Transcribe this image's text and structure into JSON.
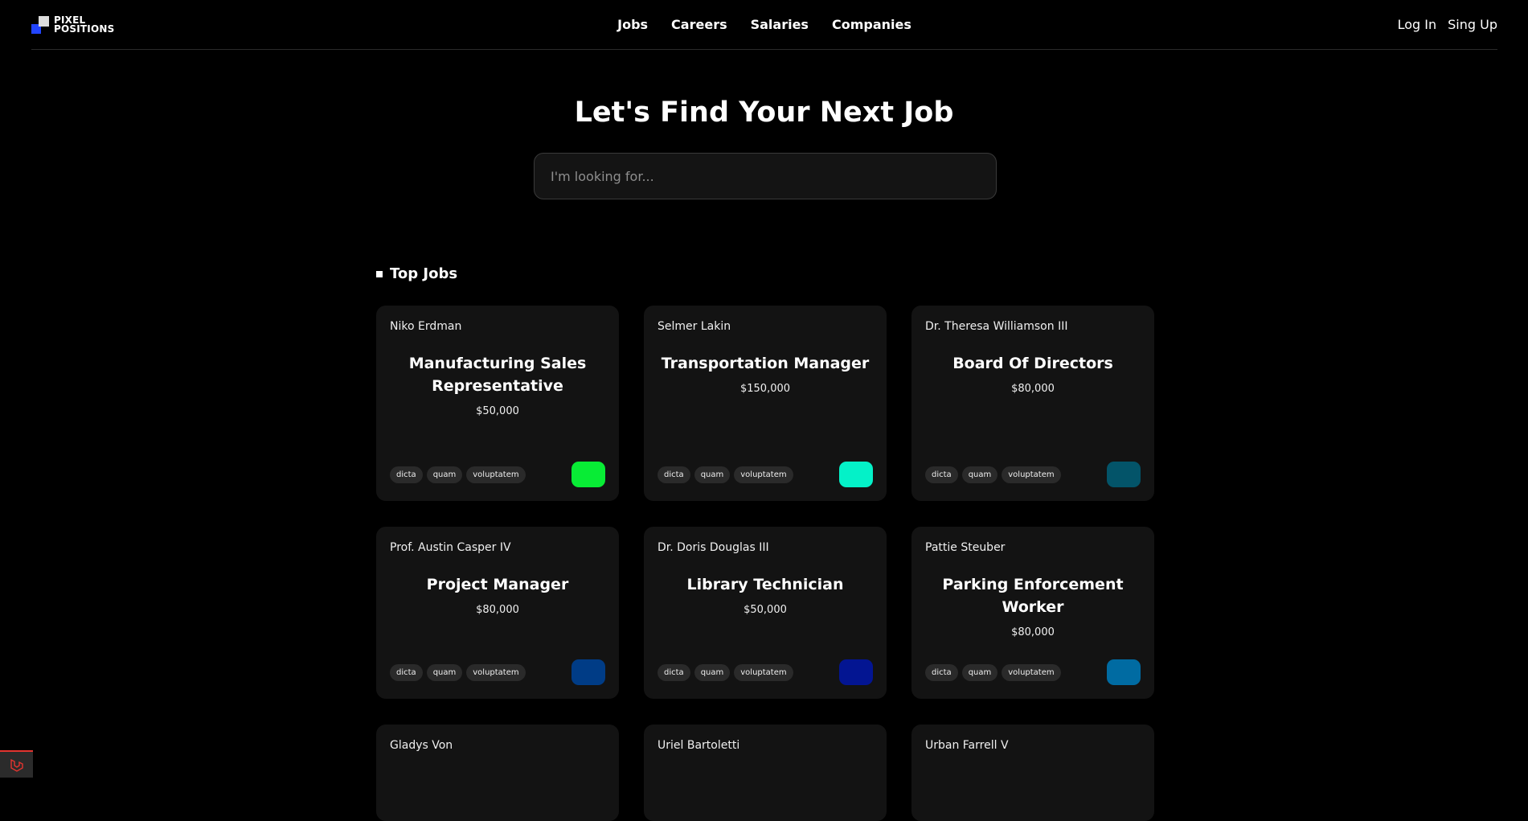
{
  "brand": {
    "line1": "PIXEL",
    "line2": "POSITIONS"
  },
  "nav": {
    "links": [
      "Jobs",
      "Careers",
      "Salaries",
      "Companies"
    ],
    "login": "Log In",
    "signup": "Sing Up"
  },
  "hero": {
    "title": "Let's Find Your Next Job",
    "search_placeholder": "I'm looking for..."
  },
  "section": {
    "title": "Top Jobs"
  },
  "jobs": [
    {
      "employer": "Niko Erdman",
      "title": "Manufacturing Sales Representative",
      "salary": "$50,000",
      "tags": [
        "dicta",
        "quam",
        "voluptatem"
      ],
      "logo_color": "#08ec35"
    },
    {
      "employer": "Selmer Lakin",
      "title": "Transportation Manager",
      "salary": "$150,000",
      "tags": [
        "dicta",
        "quam",
        "voluptatem"
      ],
      "logo_color": "#04f1c8"
    },
    {
      "employer": "Dr. Theresa Williamson III",
      "title": "Board Of Directors",
      "salary": "$80,000",
      "tags": [
        "dicta",
        "quam",
        "voluptatem"
      ],
      "logo_color": "#035469"
    },
    {
      "employer": "Prof. Austin Casper IV",
      "title": "Project Manager",
      "salary": "$80,000",
      "tags": [
        "dicta",
        "quam",
        "voluptatem"
      ],
      "logo_color": "#003c86"
    },
    {
      "employer": "Dr. Doris Douglas III",
      "title": "Library Technician",
      "salary": "$50,000",
      "tags": [
        "dicta",
        "quam",
        "voluptatem"
      ],
      "logo_color": "#031592"
    },
    {
      "employer": "Pattie Steuber",
      "title": "Parking Enforcement Worker",
      "salary": "$80,000",
      "tags": [
        "dicta",
        "quam",
        "voluptatem"
      ],
      "logo_color": "#006ba2"
    },
    {
      "employer": "Gladys Von"
    },
    {
      "employer": "Uriel Bartoletti"
    },
    {
      "employer": "Urban Farrell V"
    }
  ]
}
